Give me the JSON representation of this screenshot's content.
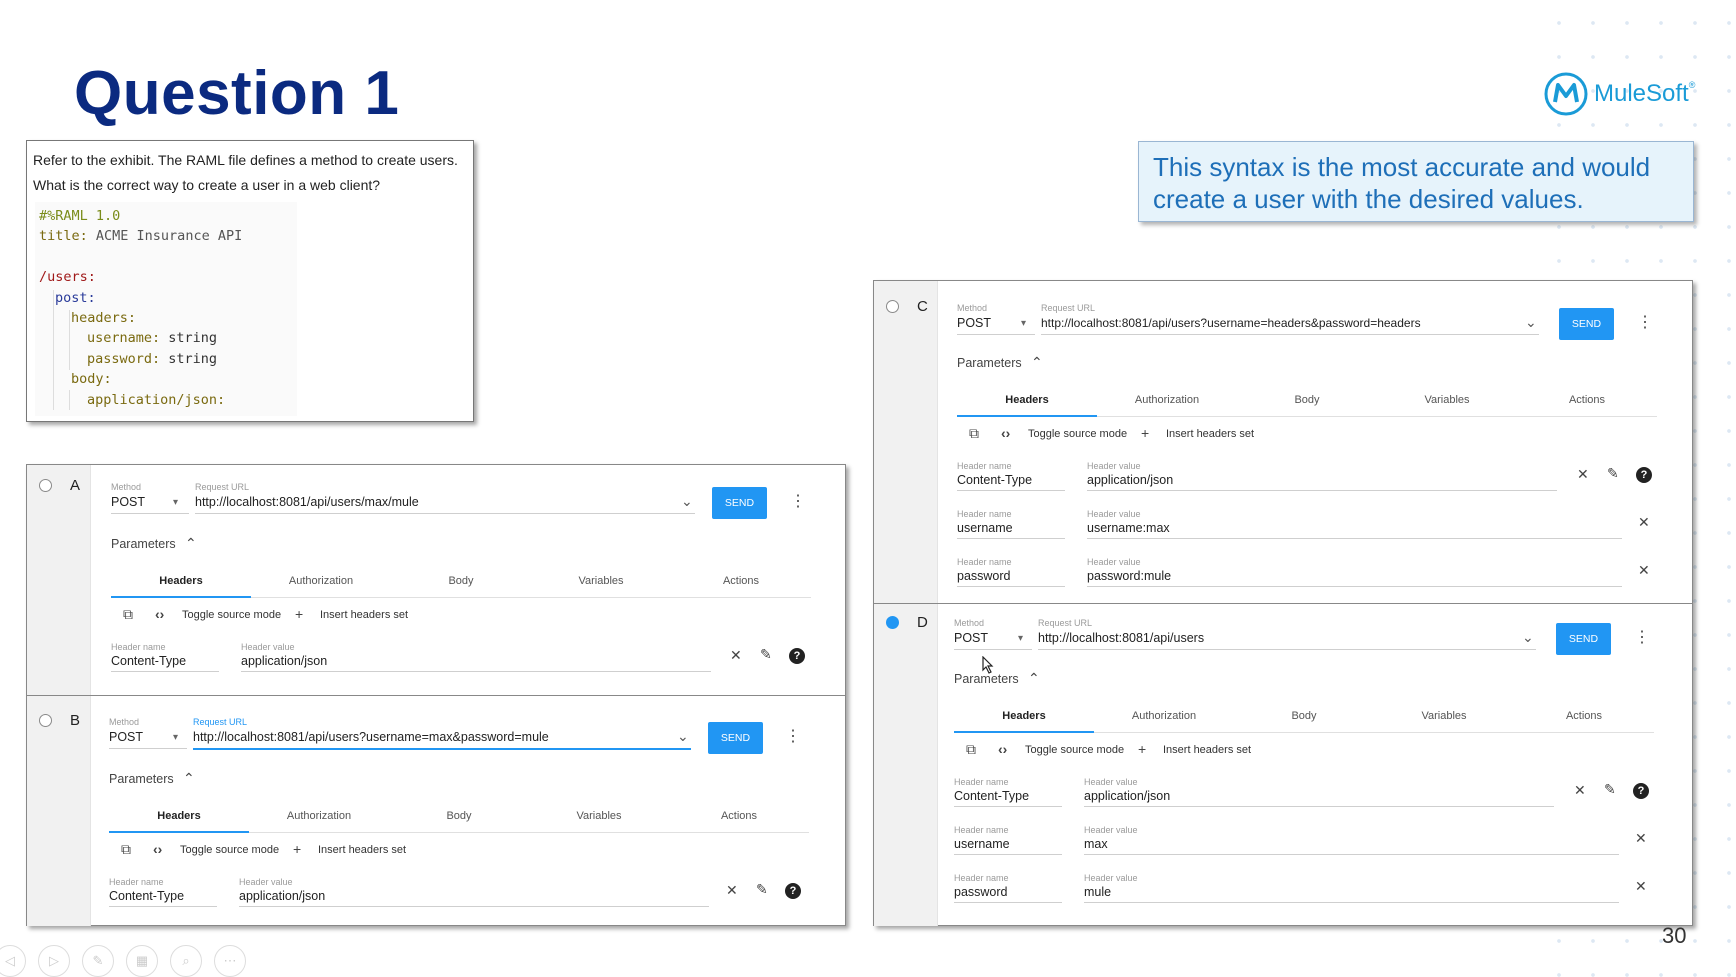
{
  "slide": {
    "title": "Question 1",
    "page_number": "30",
    "logo_text": "MuleSoft",
    "logo_reg": "®"
  },
  "question": {
    "line1": "Refer to the exhibit. The RAML file defines a method to create users.",
    "line2": "What is the correct way to create a user in a web client?",
    "code": {
      "l1": "#%RAML 1.0",
      "l2_key": "title:",
      "l2_val": " ACME Insurance API",
      "l3": "/users:",
      "l4": "post:",
      "l5": "headers:",
      "l6_key": "username:",
      "l6_val": " string",
      "l7_key": "password:",
      "l7_val": " string",
      "l8": "body:",
      "l9": "application/json:"
    }
  },
  "answer_note": {
    "line1": "This syntax is the most accurate and would",
    "line2": "create a user with the desired values."
  },
  "common": {
    "method_label": "Method",
    "url_label": "Request URL",
    "method": "POST",
    "send": "SEND",
    "parameters": "Parameters",
    "tabs": [
      "Headers",
      "Authorization",
      "Body",
      "Variables",
      "Actions"
    ],
    "toggle_source": "Toggle source mode",
    "insert_headers": "Insert headers set",
    "header_name_label": "Header name",
    "header_value_label": "Header value",
    "caret_down": "▾",
    "chevron_up": "⌃",
    "url_dropdown": "⌄",
    "kebab": "⋮",
    "close": "✕",
    "edit": "✎",
    "help": "?",
    "copy": "⧉",
    "code": "‹›",
    "plus": "+"
  },
  "options": {
    "A": {
      "letter": "A",
      "selected": false,
      "url": "http://localhost:8081/api/users/max/mule",
      "headers": [
        {
          "name": "Content-Type",
          "value": "application/json"
        }
      ]
    },
    "B": {
      "letter": "B",
      "selected": false,
      "url": "http://localhost:8081/api/users?username=max&password=mule",
      "headers": [
        {
          "name": "Content-Type",
          "value": "application/json"
        }
      ]
    },
    "C": {
      "letter": "C",
      "selected": false,
      "url": "http://localhost:8081/api/users?username=headers&password=headers",
      "headers": [
        {
          "name": "Content-Type",
          "value": "application/json"
        },
        {
          "name": "username",
          "value": "username:max"
        },
        {
          "name": "password",
          "value": "password:mule"
        }
      ]
    },
    "D": {
      "letter": "D",
      "selected": true,
      "url": "http://localhost:8081/api/users",
      "headers": [
        {
          "name": "Content-Type",
          "value": "application/json"
        },
        {
          "name": "username",
          "value": "max"
        },
        {
          "name": "password",
          "value": "mule"
        }
      ]
    }
  },
  "nav": {
    "prev": "◁",
    "play": "▷",
    "pen": "✎",
    "slides": "▦",
    "zoom": "⌕",
    "more": "⋯"
  },
  "icons": {
    "cursor": "pointer-cursor-icon"
  },
  "colors": {
    "title": "#0b2a80",
    "accent": "#2196f3",
    "note_text": "#1e6fb8",
    "logo": "#1a9bd7"
  }
}
